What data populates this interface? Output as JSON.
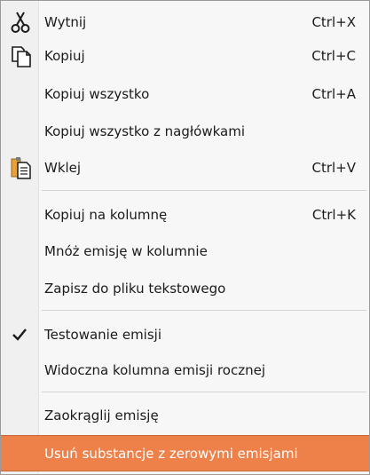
{
  "menu": {
    "items": [
      {
        "label": "Wytnij",
        "shortcut": "Ctrl+X",
        "icon": "scissors-icon"
      },
      {
        "label": "Kopiuj",
        "shortcut": "Ctrl+C",
        "icon": "copy-icon"
      },
      {
        "label": "Kopiuj wszystko",
        "shortcut": "Ctrl+A"
      },
      {
        "label": "Kopiuj wszystko z nagłówkami",
        "shortcut": ""
      },
      {
        "label": "Wklej",
        "shortcut": "Ctrl+V",
        "icon": "paste-icon"
      },
      {
        "label": "Kopiuj na kolumnę",
        "shortcut": "Ctrl+K"
      },
      {
        "label": "Mnóż emisję w kolumnie",
        "shortcut": ""
      },
      {
        "label": "Zapisz do pliku tekstowego",
        "shortcut": ""
      },
      {
        "label": "Testowanie emisji",
        "shortcut": "",
        "checked": true,
        "icon": "checkmark-icon"
      },
      {
        "label": "Widoczna kolumna emisji rocznej",
        "shortcut": ""
      },
      {
        "label": "Zaokrąglij emisję",
        "shortcut": ""
      },
      {
        "label": "Usuń substancje z zerowymi emisjami",
        "shortcut": "",
        "highlighted": true
      }
    ]
  },
  "colors": {
    "highlight": "#ed8149",
    "highlight_text": "#ffffff",
    "text": "#1b1b1b",
    "menu_background": "#f7f7f7"
  }
}
